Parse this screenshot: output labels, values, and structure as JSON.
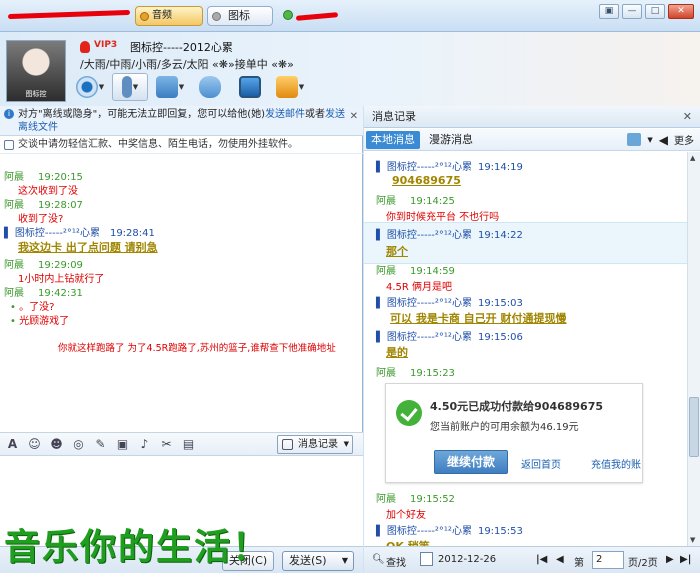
{
  "topbar": {
    "tab_video_label": "音频",
    "tab_icon_label": "图标",
    "window_buttons": [
      "▣",
      "—",
      "□",
      "✕"
    ]
  },
  "profile": {
    "vip": "VIP3",
    "nickname": "图标控-----2012心累",
    "status_line": "/大雨/中雨/小雨/多云/太阳 «❋»接单中 «❋»",
    "avatar_caption": "图标控"
  },
  "left": {
    "notice1_prefix": "对方\"离线或隐身\"，可能无法立即回复，您可以给他(她)",
    "notice1_link1": "发送邮件",
    "notice1_mid": "或者",
    "notice1_link2": "发送离线文件",
    "notice2": "交谈中请勿轻信汇款、中奖信息、陌生电话，勿使用外挂软件。",
    "messages": [
      {
        "sender": "阿晨",
        "time": "19:20:15",
        "text": "这次收到了没"
      },
      {
        "sender": "阿晨",
        "time": "19:28:07",
        "text": "收到了没?"
      },
      {
        "sender": "图标控-----²°¹²心累",
        "time": "19:28:41",
        "text": "我这边卡 出了点问题   请别急"
      },
      {
        "sender": "阿晨",
        "time": "19:29:09",
        "text": "1小时内上钻就行了"
      },
      {
        "sender": "阿晨",
        "time": "19:42:31",
        "text": "。了没?"
      },
      {
        "text": "光顾游戏了"
      }
    ],
    "annotation": "你就这样跑路了  为了4.5R跑路了,苏州的篮子,谁帮查下他准确地址",
    "history_button": "消息记录",
    "close_button": "关闭(C)",
    "send_button": "发送(S)",
    "overlay_text": "音乐你的生活！"
  },
  "right": {
    "title": "消息记录",
    "tab_local": "本地消息",
    "tab_roam": "漫游消息",
    "more": "更多",
    "log": [
      {
        "sender": "图标控-----²°¹²心累",
        "time": "19:14:19",
        "text": "904689675"
      },
      {
        "sender": "阿晨",
        "time": "19:14:25",
        "text": "你到时候充平台  不也行吗"
      },
      {
        "sender": "图标控-----²°¹²心累",
        "time": "19:14:22",
        "text": "那个"
      },
      {
        "sender": "阿晨",
        "time": "19:14:59",
        "text": "4.5R  俩月是吧"
      },
      {
        "sender": "图标控-----²°¹²心累",
        "time": "19:15:03",
        "text": "可以  我是卡商 自己开   财付通提现慢"
      },
      {
        "sender": "图标控-----²°¹²心累",
        "time": "19:15:06",
        "text": "是的"
      },
      {
        "sender": "阿晨",
        "time": "19:15:23"
      },
      {
        "sender": "阿晨",
        "time": "19:15:52",
        "text": "加个好友"
      },
      {
        "sender": "图标控-----²°¹²心累",
        "time": "19:15:53",
        "text": "OK  稍等"
      }
    ],
    "payment": {
      "title": "4.50元已成功付款给904689675",
      "balance": "您当前账户的可用余额为46.19元",
      "button": "继续付款",
      "link_home": "返回首页",
      "link_recharge": "充值我的账"
    },
    "bottom": {
      "find": "查找",
      "date": "2012-12-26",
      "page_prefix": "第",
      "page_value": "2",
      "page_total": "页/2页"
    }
  },
  "colors": {
    "accent": "#3a8ad4",
    "sender_green": "#3a9a2a",
    "sender_blue": "#1f4fa8",
    "msg_red": "#e00000",
    "msg_gold": "#a08600",
    "overlay_green": "#1f9e1f",
    "scribble_red": "#e8000b"
  }
}
